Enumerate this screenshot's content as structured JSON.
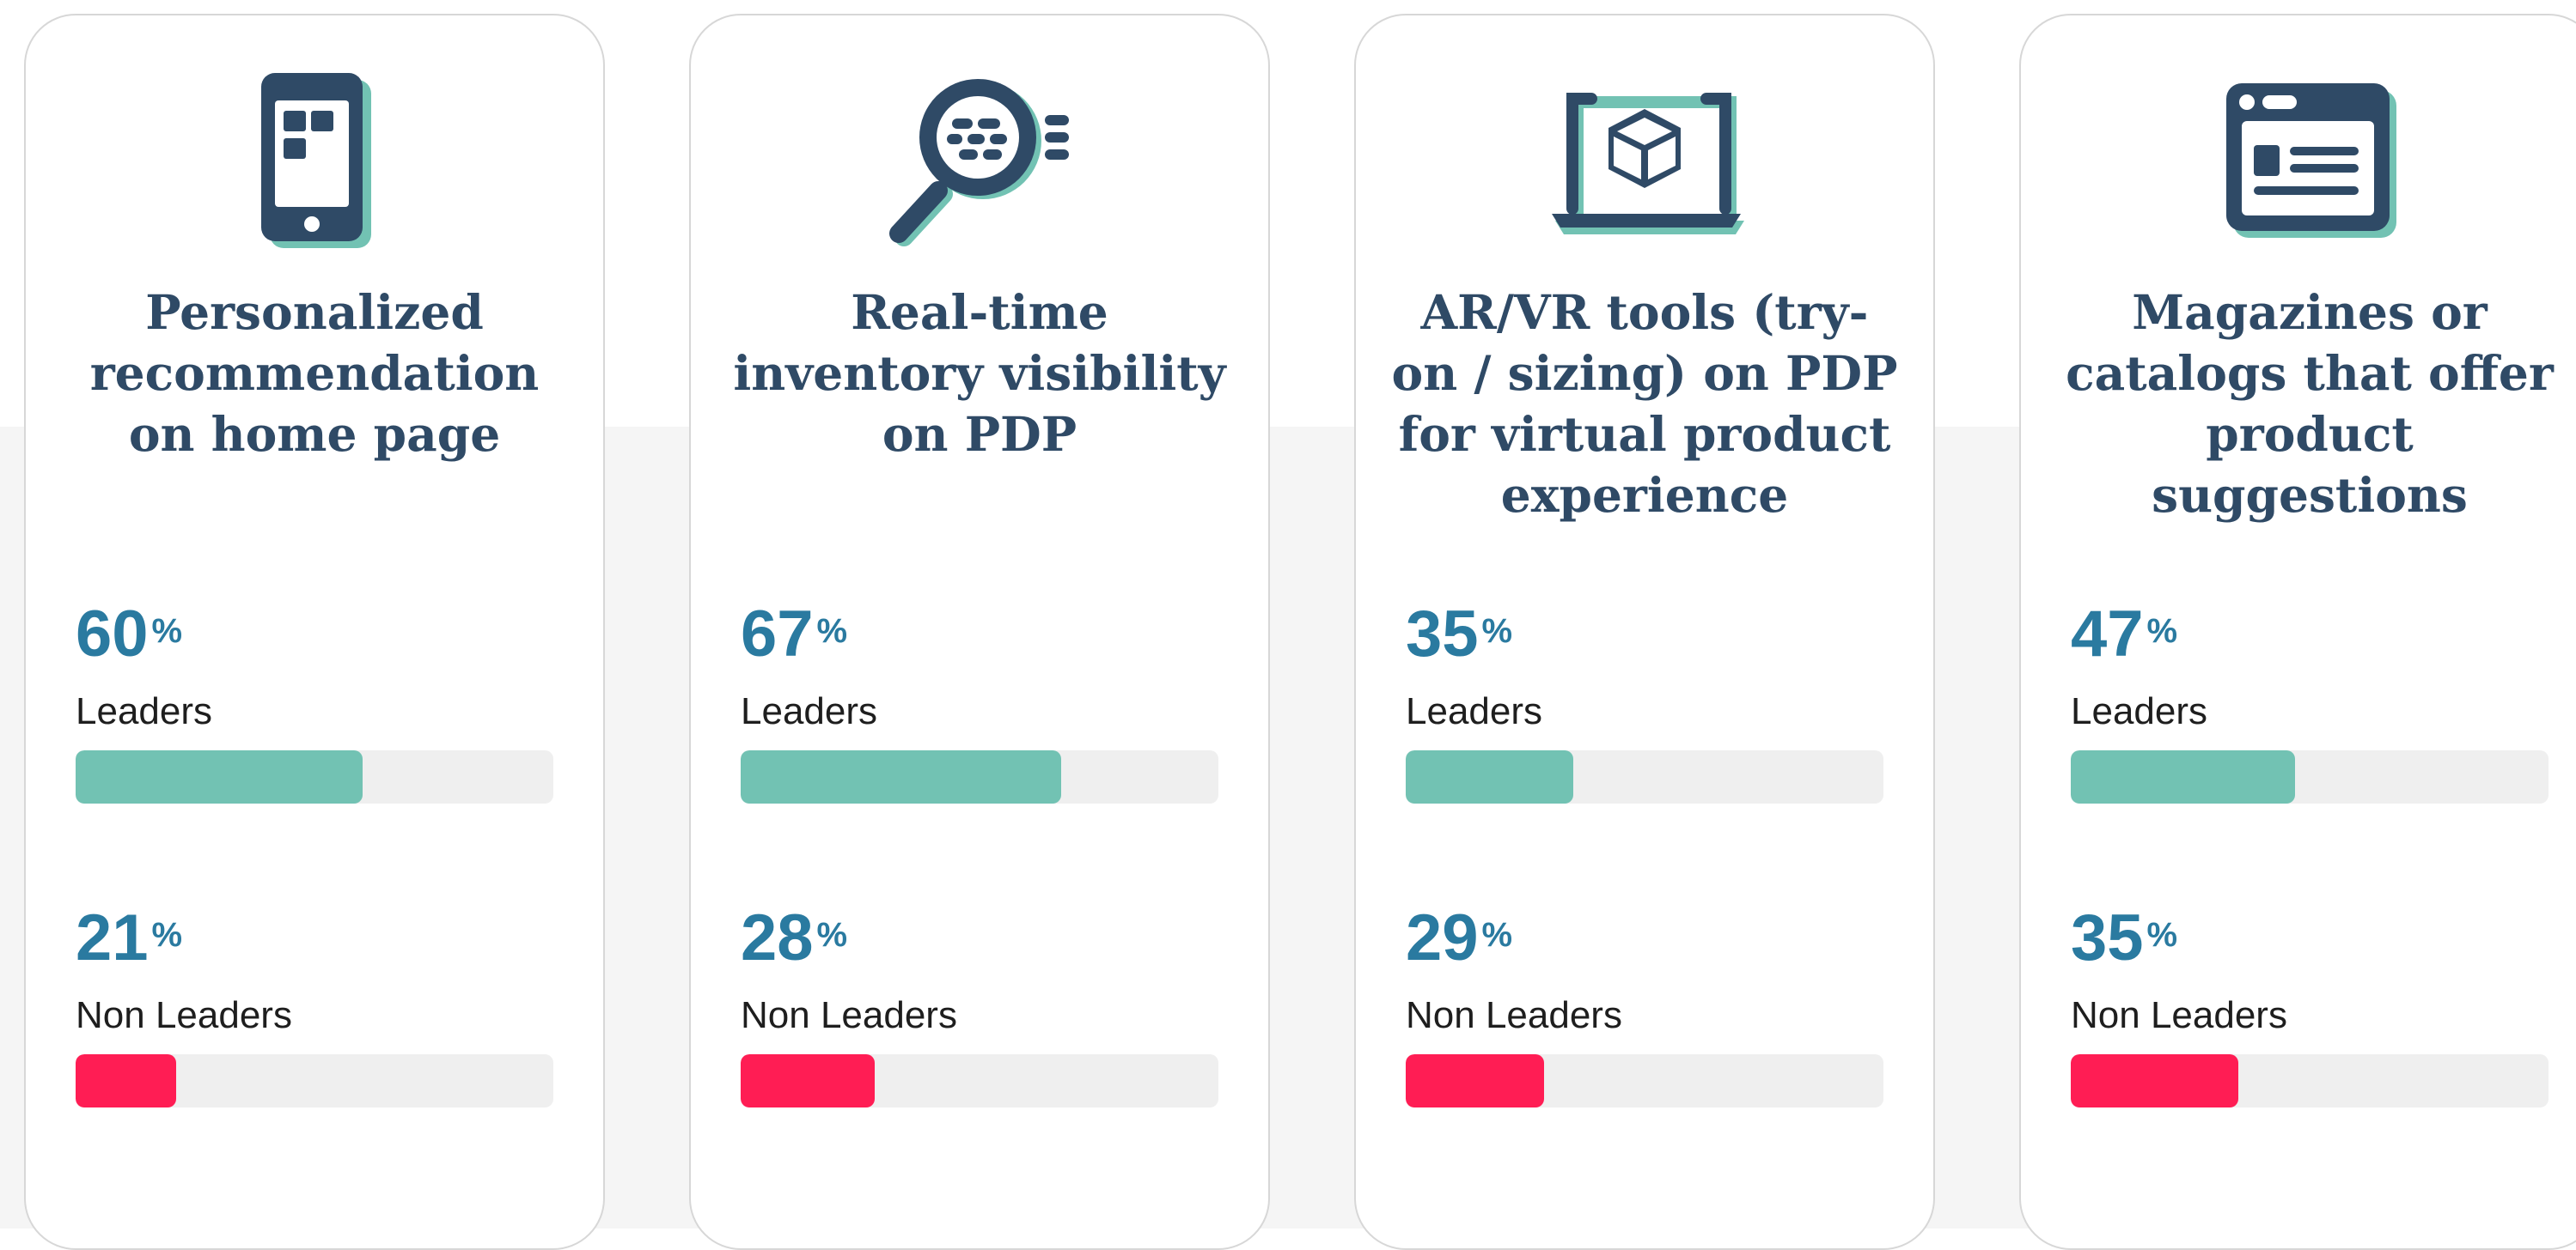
{
  "colors": {
    "leaders_bar": "#72c2b3",
    "non_leaders_bar": "#ff1d54",
    "value_text": "#2a7aa0",
    "title_text": "#2f4a66"
  },
  "chart_data": {
    "type": "bar",
    "categories": [
      "Personalized recommendation on home page",
      "Real-time inventory visibility on PDP",
      "AR/VR tools (try-on / sizing) on PDP for virtual product experience",
      "Magazines or catalogs that offer product suggestions"
    ],
    "series": [
      {
        "name": "Leaders",
        "values": [
          60,
          67,
          35,
          47
        ]
      },
      {
        "name": "Non Leaders",
        "values": [
          21,
          28,
          29,
          35
        ]
      }
    ],
    "ylim": [
      0,
      100
    ],
    "title": "",
    "xlabel": "",
    "ylabel": ""
  },
  "cards": [
    {
      "icon": "smartphone-icon",
      "title": "Personalized recommendation on home page",
      "leaders": {
        "value": "60",
        "unit": "%",
        "label": "Leaders"
      },
      "non_leaders": {
        "value": "21",
        "unit": "%",
        "label": "Non Leaders"
      }
    },
    {
      "icon": "magnifier-icon",
      "title": "Real-time inventory visibility on PDP",
      "leaders": {
        "value": "67",
        "unit": "%",
        "label": "Leaders"
      },
      "non_leaders": {
        "value": "28",
        "unit": "%",
        "label": "Non Leaders"
      }
    },
    {
      "icon": "laptop-cube-icon",
      "title": "AR/VR tools (try-on / sizing) on PDP for virtual product experience",
      "leaders": {
        "value": "35",
        "unit": "%",
        "label": "Leaders"
      },
      "non_leaders": {
        "value": "29",
        "unit": "%",
        "label": "Non Leaders"
      }
    },
    {
      "icon": "browser-window-icon",
      "title": "Magazines or catalogs that offer product suggestions",
      "leaders": {
        "value": "47",
        "unit": "%",
        "label": "Leaders"
      },
      "non_leaders": {
        "value": "35",
        "unit": "%",
        "label": "Non Leaders"
      }
    }
  ]
}
